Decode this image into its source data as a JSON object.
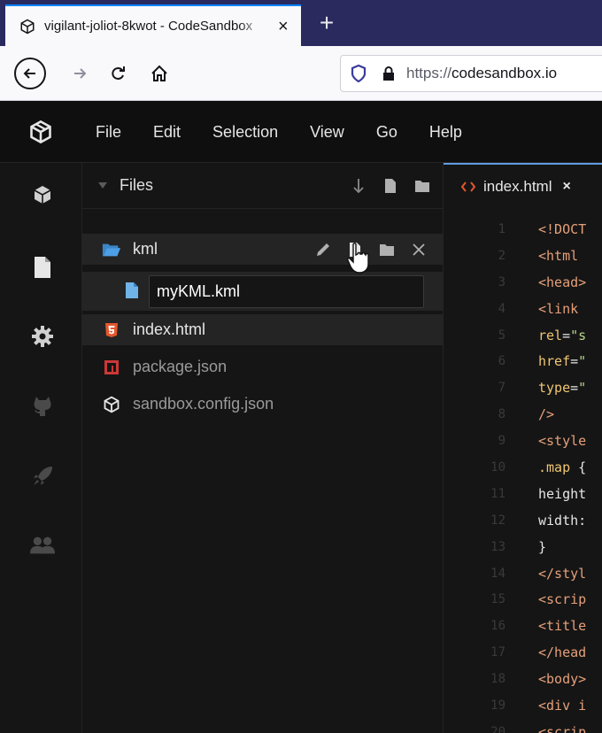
{
  "browser": {
    "tab_title": "vigilant-joliot-8kwot - CodeSandbox",
    "tab_close": "×",
    "new_tab": "+",
    "url_scheme": "https://",
    "url_host": "codesandbox.io"
  },
  "menu": [
    "File",
    "Edit",
    "Selection",
    "View",
    "Go",
    "Help"
  ],
  "activity_icons": [
    "box-icon",
    "file-icon",
    "gear-icon",
    "github-icon",
    "rocket-icon",
    "users-icon"
  ],
  "explorer": {
    "header": "Files",
    "folder": "kml",
    "new_file_value": "myKML.kml",
    "files": [
      "index.html",
      "package.json",
      "sandbox.config.json"
    ]
  },
  "editor": {
    "tab_name": "index.html",
    "tab_close": "×",
    "lines": [
      {
        "n": "1",
        "parts": [
          [
            "t-tag",
            "<!DOCT"
          ]
        ]
      },
      {
        "n": "2",
        "parts": [
          [
            "t-tag",
            "<html"
          ]
        ]
      },
      {
        "n": "3",
        "parts": [
          [
            "t-tag",
            "<head>"
          ]
        ]
      },
      {
        "n": "4",
        "parts": [
          [
            "t-tag",
            "<link"
          ]
        ]
      },
      {
        "n": "5",
        "parts": [
          [
            "t-attr",
            "rel"
          ],
          [
            "t-txt",
            "="
          ],
          [
            "t-str",
            "\"s"
          ]
        ]
      },
      {
        "n": "6",
        "parts": [
          [
            "t-attr",
            "href"
          ],
          [
            "t-txt",
            "="
          ],
          [
            "t-str",
            "\""
          ]
        ]
      },
      {
        "n": "7",
        "parts": [
          [
            "t-attr",
            "type"
          ],
          [
            "t-txt",
            "="
          ],
          [
            "t-str",
            "\""
          ]
        ]
      },
      {
        "n": "8",
        "parts": [
          [
            "t-tag",
            "/>"
          ]
        ]
      },
      {
        "n": "9",
        "parts": [
          [
            "t-tag",
            "<style"
          ]
        ]
      },
      {
        "n": "10",
        "parts": [
          [
            "t-attr",
            ".map"
          ],
          [
            "t-txt",
            " {"
          ]
        ]
      },
      {
        "n": "11",
        "parts": [
          [
            "t-txt",
            "height"
          ]
        ]
      },
      {
        "n": "12",
        "parts": [
          [
            "t-txt",
            "width:"
          ]
        ]
      },
      {
        "n": "13",
        "parts": [
          [
            "t-txt",
            "}"
          ]
        ]
      },
      {
        "n": "14",
        "parts": [
          [
            "t-tag",
            "</styl"
          ]
        ]
      },
      {
        "n": "15",
        "parts": [
          [
            "t-tag",
            "<scrip"
          ]
        ]
      },
      {
        "n": "16",
        "parts": [
          [
            "t-tag",
            "<title"
          ]
        ]
      },
      {
        "n": "17",
        "parts": [
          [
            "t-tag",
            "</head"
          ]
        ]
      },
      {
        "n": "18",
        "parts": [
          [
            "t-tag",
            "<body>"
          ]
        ]
      },
      {
        "n": "19",
        "parts": [
          [
            "t-tag",
            "<div i"
          ]
        ]
      },
      {
        "n": "20",
        "parts": [
          [
            "t-tag",
            "<scrip"
          ]
        ]
      }
    ]
  },
  "colors": {
    "accent": "#0a84ff",
    "editor_tab_accent": "#5d9be0",
    "folder_icon": "#4d9fe6",
    "html5_icon": "#e4572e",
    "npm_icon": "#cb3837"
  }
}
